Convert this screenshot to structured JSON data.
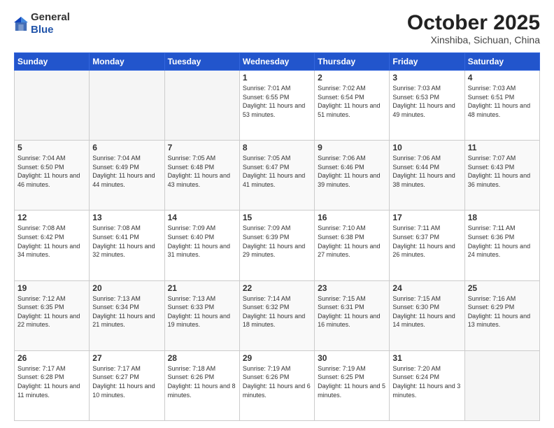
{
  "header": {
    "logo_general": "General",
    "logo_blue": "Blue",
    "month": "October 2025",
    "location": "Xinshiba, Sichuan, China"
  },
  "days_of_week": [
    "Sunday",
    "Monday",
    "Tuesday",
    "Wednesday",
    "Thursday",
    "Friday",
    "Saturday"
  ],
  "weeks": [
    [
      {
        "day": "",
        "info": ""
      },
      {
        "day": "",
        "info": ""
      },
      {
        "day": "",
        "info": ""
      },
      {
        "day": "1",
        "info": "Sunrise: 7:01 AM\nSunset: 6:55 PM\nDaylight: 11 hours and 53 minutes."
      },
      {
        "day": "2",
        "info": "Sunrise: 7:02 AM\nSunset: 6:54 PM\nDaylight: 11 hours and 51 minutes."
      },
      {
        "day": "3",
        "info": "Sunrise: 7:03 AM\nSunset: 6:53 PM\nDaylight: 11 hours and 49 minutes."
      },
      {
        "day": "4",
        "info": "Sunrise: 7:03 AM\nSunset: 6:51 PM\nDaylight: 11 hours and 48 minutes."
      }
    ],
    [
      {
        "day": "5",
        "info": "Sunrise: 7:04 AM\nSunset: 6:50 PM\nDaylight: 11 hours and 46 minutes."
      },
      {
        "day": "6",
        "info": "Sunrise: 7:04 AM\nSunset: 6:49 PM\nDaylight: 11 hours and 44 minutes."
      },
      {
        "day": "7",
        "info": "Sunrise: 7:05 AM\nSunset: 6:48 PM\nDaylight: 11 hours and 43 minutes."
      },
      {
        "day": "8",
        "info": "Sunrise: 7:05 AM\nSunset: 6:47 PM\nDaylight: 11 hours and 41 minutes."
      },
      {
        "day": "9",
        "info": "Sunrise: 7:06 AM\nSunset: 6:46 PM\nDaylight: 11 hours and 39 minutes."
      },
      {
        "day": "10",
        "info": "Sunrise: 7:06 AM\nSunset: 6:44 PM\nDaylight: 11 hours and 38 minutes."
      },
      {
        "day": "11",
        "info": "Sunrise: 7:07 AM\nSunset: 6:43 PM\nDaylight: 11 hours and 36 minutes."
      }
    ],
    [
      {
        "day": "12",
        "info": "Sunrise: 7:08 AM\nSunset: 6:42 PM\nDaylight: 11 hours and 34 minutes."
      },
      {
        "day": "13",
        "info": "Sunrise: 7:08 AM\nSunset: 6:41 PM\nDaylight: 11 hours and 32 minutes."
      },
      {
        "day": "14",
        "info": "Sunrise: 7:09 AM\nSunset: 6:40 PM\nDaylight: 11 hours and 31 minutes."
      },
      {
        "day": "15",
        "info": "Sunrise: 7:09 AM\nSunset: 6:39 PM\nDaylight: 11 hours and 29 minutes."
      },
      {
        "day": "16",
        "info": "Sunrise: 7:10 AM\nSunset: 6:38 PM\nDaylight: 11 hours and 27 minutes."
      },
      {
        "day": "17",
        "info": "Sunrise: 7:11 AM\nSunset: 6:37 PM\nDaylight: 11 hours and 26 minutes."
      },
      {
        "day": "18",
        "info": "Sunrise: 7:11 AM\nSunset: 6:36 PM\nDaylight: 11 hours and 24 minutes."
      }
    ],
    [
      {
        "day": "19",
        "info": "Sunrise: 7:12 AM\nSunset: 6:35 PM\nDaylight: 11 hours and 22 minutes."
      },
      {
        "day": "20",
        "info": "Sunrise: 7:13 AM\nSunset: 6:34 PM\nDaylight: 11 hours and 21 minutes."
      },
      {
        "day": "21",
        "info": "Sunrise: 7:13 AM\nSunset: 6:33 PM\nDaylight: 11 hours and 19 minutes."
      },
      {
        "day": "22",
        "info": "Sunrise: 7:14 AM\nSunset: 6:32 PM\nDaylight: 11 hours and 18 minutes."
      },
      {
        "day": "23",
        "info": "Sunrise: 7:15 AM\nSunset: 6:31 PM\nDaylight: 11 hours and 16 minutes."
      },
      {
        "day": "24",
        "info": "Sunrise: 7:15 AM\nSunset: 6:30 PM\nDaylight: 11 hours and 14 minutes."
      },
      {
        "day": "25",
        "info": "Sunrise: 7:16 AM\nSunset: 6:29 PM\nDaylight: 11 hours and 13 minutes."
      }
    ],
    [
      {
        "day": "26",
        "info": "Sunrise: 7:17 AM\nSunset: 6:28 PM\nDaylight: 11 hours and 11 minutes."
      },
      {
        "day": "27",
        "info": "Sunrise: 7:17 AM\nSunset: 6:27 PM\nDaylight: 11 hours and 10 minutes."
      },
      {
        "day": "28",
        "info": "Sunrise: 7:18 AM\nSunset: 6:26 PM\nDaylight: 11 hours and 8 minutes."
      },
      {
        "day": "29",
        "info": "Sunrise: 7:19 AM\nSunset: 6:26 PM\nDaylight: 11 hours and 6 minutes."
      },
      {
        "day": "30",
        "info": "Sunrise: 7:19 AM\nSunset: 6:25 PM\nDaylight: 11 hours and 5 minutes."
      },
      {
        "day": "31",
        "info": "Sunrise: 7:20 AM\nSunset: 6:24 PM\nDaylight: 11 hours and 3 minutes."
      },
      {
        "day": "",
        "info": ""
      }
    ]
  ]
}
